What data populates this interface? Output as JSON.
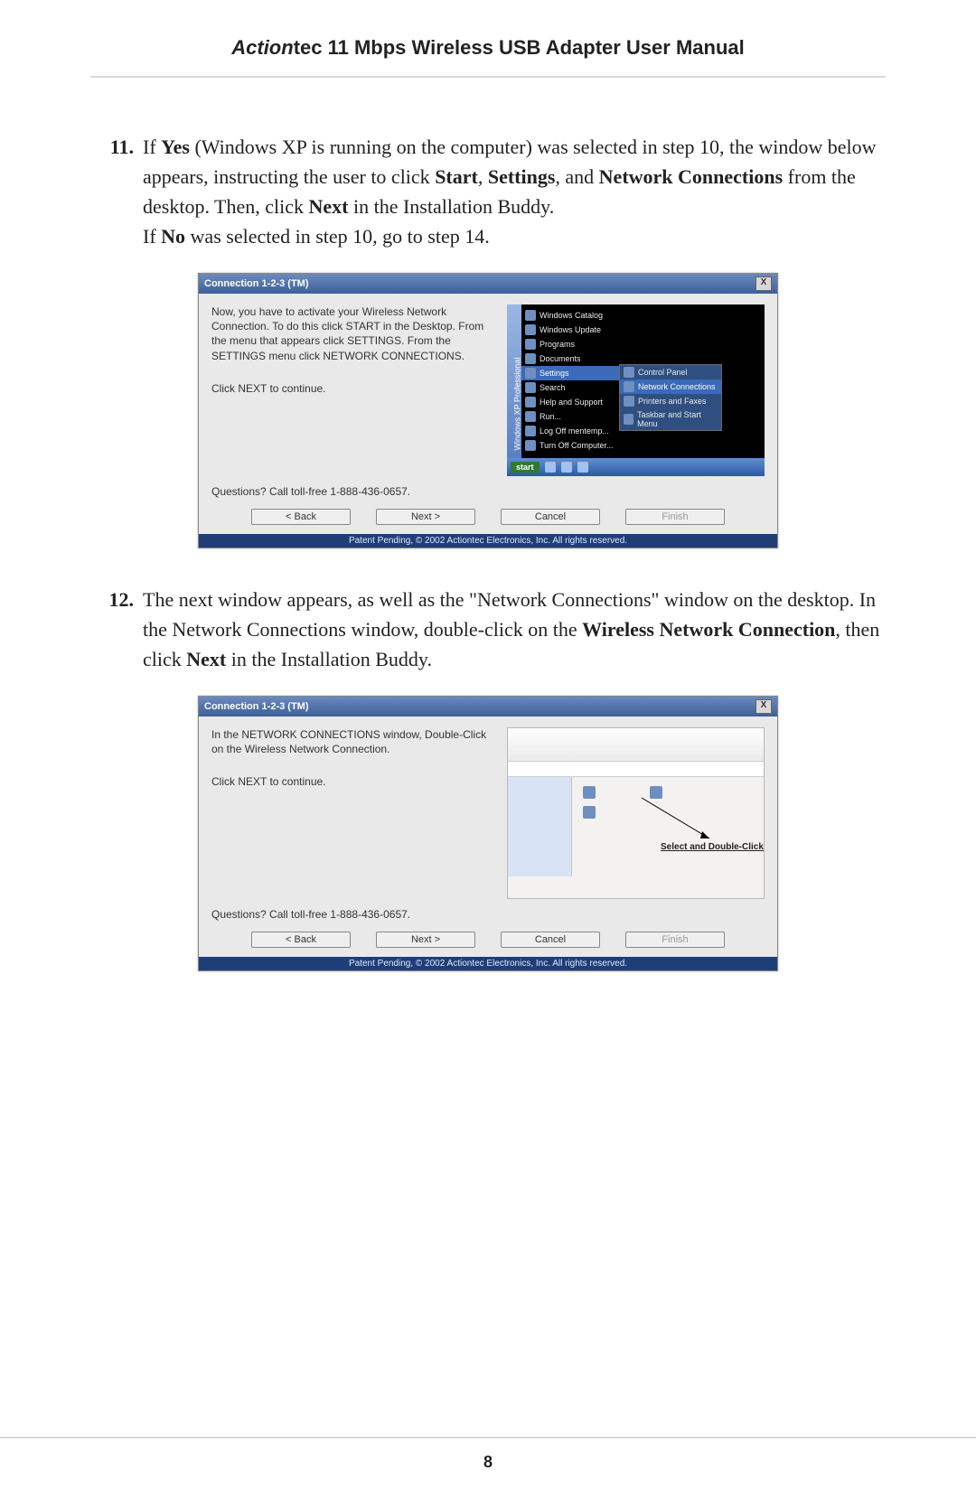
{
  "header": {
    "brand_bold": "Action",
    "brand_rest": "tec 11 Mbps Wireless USB Adapter User Manual"
  },
  "step11": {
    "num": "11.",
    "t1a": "If ",
    "t1b": "Yes",
    "t1c": " (Windows XP is running on the computer) was selected in step 10, the window below appears, instructing the user to click ",
    "t1d": "Start",
    "t1e": ", ",
    "t1f": "Settings",
    "t1g": ", and ",
    "t1h": "Network Connections",
    "t1i": " from the desktop. Then, click ",
    "t1j": "Next",
    "t1k": " in the Installation Buddy.",
    "t2a": "If ",
    "t2b": "No",
    "t2c": " was selected in step 10, go to step 14."
  },
  "shot1": {
    "title": "Connection 1-2-3 (TM)",
    "close": "X",
    "p1": "Now, you have to activate your Wireless Network Connection. To do this click START in the Desktop. From the menu that appears click SETTINGS. From the SETTINGS menu click NETWORK CONNECTIONS.",
    "p2": "Click NEXT to continue.",
    "q": "Questions? Call toll-free 1-888-436-0657.",
    "btn_back": "< Back",
    "btn_next": "Next >",
    "btn_cancel": "Cancel",
    "btn_finish": "Finish",
    "foot": "Patent Pending, © 2002 Actiontec Electronics, Inc. All rights reserved.",
    "menu": {
      "sidebar": "Windows XP  Professional",
      "items": [
        "Windows Catalog",
        "Windows Update",
        "Programs",
        "Documents",
        "Settings",
        "Search",
        "Help and Support",
        "Run...",
        "Log Off mentemp...",
        "Turn Off Computer..."
      ],
      "sub": [
        "Control Panel",
        "Network Connections",
        "Printers and Faxes",
        "Taskbar and Start Menu"
      ],
      "start": "start"
    }
  },
  "step12": {
    "num": "12.",
    "t1": "The next window appears, as well as the \"Network Connections\" window on the desktop. In the Network Connections window, double-click on the ",
    "t2": "Wireless Network Connection",
    "t3": ", then click ",
    "t4": "Next",
    "t5": " in the Installation Buddy."
  },
  "shot2": {
    "title": "Connection 1-2-3 (TM)",
    "close": "X",
    "p1": "In the NETWORK CONNECTIONS window, Double-Click on the Wireless Network Connection.",
    "p2": "Click NEXT to continue.",
    "q": "Questions? Call toll-free 1-888-436-0657.",
    "btn_back": "< Back",
    "btn_next": "Next >",
    "btn_cancel": "Cancel",
    "btn_finish": "Finish",
    "foot": "Patent Pending, © 2002 Actiontec Electronics, Inc. All rights reserved.",
    "nc_label": "Select and Double-Click"
  },
  "page_number": "8"
}
